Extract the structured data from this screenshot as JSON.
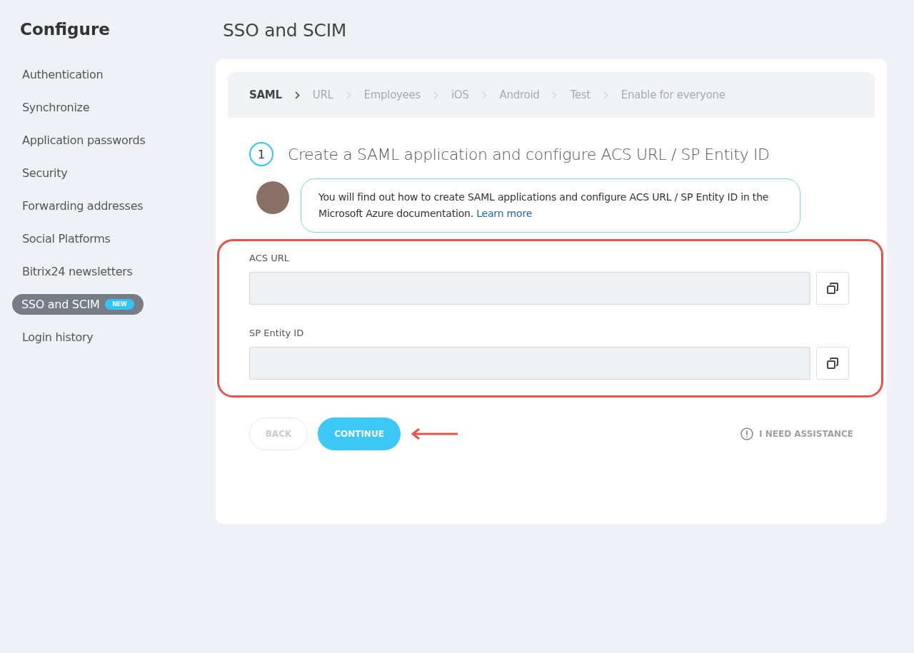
{
  "sidebar": {
    "title": "Configure",
    "items": [
      {
        "label": "Authentication",
        "selected": false
      },
      {
        "label": "Synchronize",
        "selected": false
      },
      {
        "label": "Application passwords",
        "selected": false
      },
      {
        "label": "Security",
        "selected": false
      },
      {
        "label": "Forwarding addresses",
        "selected": false
      },
      {
        "label": "Social Platforms",
        "selected": false
      },
      {
        "label": "Bitrix24 newsletters",
        "selected": false
      },
      {
        "label": "SSO and SCIM",
        "selected": true,
        "badge": "NEW"
      },
      {
        "label": "Login history",
        "selected": false
      }
    ]
  },
  "page_title": "SSO and SCIM",
  "steps": [
    {
      "label": "SAML",
      "selected": true
    },
    {
      "label": "URL",
      "selected": false
    },
    {
      "label": "Employees",
      "selected": false
    },
    {
      "label": "iOS",
      "selected": false
    },
    {
      "label": "Android",
      "selected": false
    },
    {
      "label": "Test",
      "selected": false
    },
    {
      "label": "Enable for everyone",
      "selected": false
    }
  ],
  "step_number": "1",
  "step_title": "Create a SAML application and configure ACS URL / SP Entity ID",
  "hint": {
    "text": "You will find out how to create SAML applications and configure ACS URL / SP Entity ID in the Microsoft Azure documentation.",
    "link": "Learn more"
  },
  "fields": [
    {
      "label": "ACS URL"
    },
    {
      "label": "SP Entity ID"
    }
  ],
  "buttons": {
    "back": {
      "label": "BACK",
      "disabled": true
    },
    "continue": {
      "label": "CONTINUE"
    }
  },
  "assistance": "I NEED ASSISTANCE"
}
